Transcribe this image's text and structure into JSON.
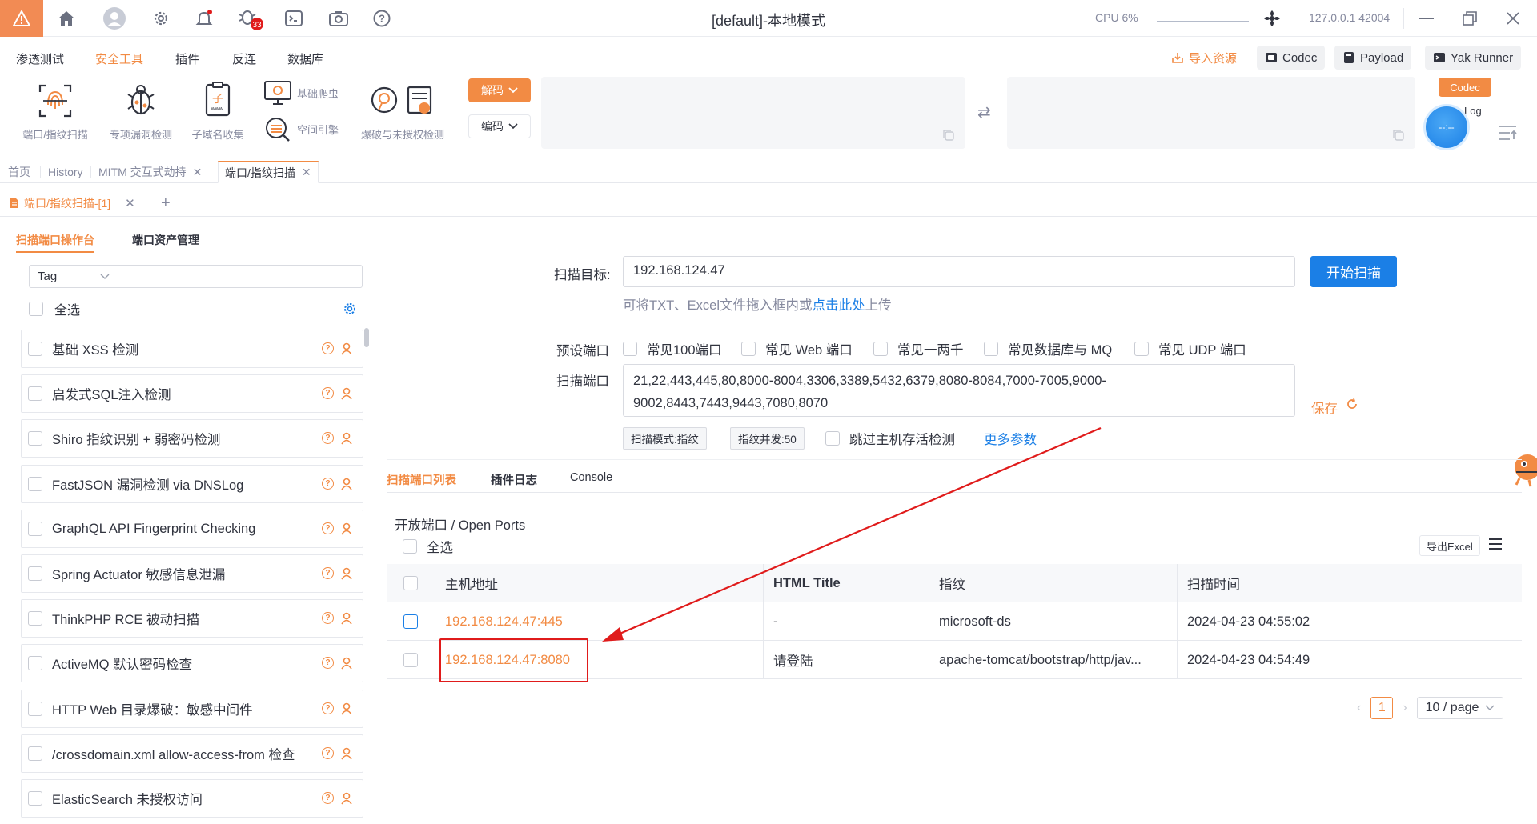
{
  "titlebar": {
    "title": "[default]-本地模式",
    "cpu": "CPU 6%",
    "address": "127.0.0.1 42004",
    "badge": "33"
  },
  "menu": {
    "items": [
      "渗透测试",
      "安全工具",
      "插件",
      "反连",
      "数据库"
    ],
    "active": "安全工具",
    "right": {
      "import": "导入资源",
      "codec": "Codec",
      "payload": "Payload",
      "runner": "Yak Runner"
    }
  },
  "toolbar": {
    "port_scan": "端口/指纹扫描",
    "vuln_detect": "专项漏洞检测",
    "subdomain": "子域名收集",
    "crawler": "基础爬虫",
    "space_engine": "空间引擎",
    "brute": "爆破与未授权检测",
    "decode": "解码",
    "encode": "编码",
    "codec_tag": "Codec",
    "log_tag": "Log",
    "float_time": "--:--"
  },
  "page_tabs": [
    {
      "label": "首页",
      "closable": false
    },
    {
      "label": "History",
      "closable": false
    },
    {
      "label": "MITM 交互式劫持",
      "closable": true
    },
    {
      "label": "端口/指纹扫描",
      "closable": true,
      "active": true
    }
  ],
  "sub_tab": {
    "label": "端口/指纹扫描-[1]"
  },
  "console_tabs": [
    "扫描端口操作台",
    "端口资产管理"
  ],
  "left": {
    "tag_label": "Tag",
    "select_all": "全选",
    "plugins": [
      "基础 XSS 检测",
      "启发式SQL注入检测",
      "Shiro 指纹识别 + 弱密码检测",
      "FastJSON 漏洞检测 via DNSLog",
      "GraphQL API Fingerprint Checking",
      "Spring Actuator 敏感信息泄漏",
      "ThinkPHP RCE 被动扫描",
      "ActiveMQ 默认密码检查",
      "HTTP Web 目录爆破：敏感中间件",
      "/crossdomain.xml allow-access-from 检查",
      "ElasticSearch 未授权访问"
    ]
  },
  "form": {
    "target_label": "扫描目标:",
    "target_value": "192.168.124.47",
    "start_button": "开始扫描",
    "hint_prefix": "可将TXT、Excel文件拖入框内或",
    "hint_link": "点击此处",
    "hint_suffix": "上传",
    "preset_label": "预设端口",
    "presets": [
      "常见100端口",
      "常见 Web 端口",
      "常见一两千",
      "常见数据库与 MQ",
      "常见 UDP 端口"
    ],
    "ports_label": "扫描端口",
    "ports_value": "21,22,443,445,80,8000-8004,3306,3389,5432,6379,8080-8084,7000-7005,9000-9002,8443,7443,9443,7080,8070",
    "save": "保存",
    "mode_tag": "扫描模式:指纹",
    "concurrency_tag": "指纹并发:50",
    "skip_label": "跳过主机存活检测",
    "more_params": "更多参数"
  },
  "results": {
    "tabs": [
      "扫描端口列表",
      "插件日志",
      "Console"
    ],
    "title": "开放端口 / Open Ports",
    "select_all": "全选",
    "export": "导出Excel",
    "columns": [
      "主机地址",
      "HTML Title",
      "指纹",
      "扫描时间"
    ],
    "rows": [
      {
        "addr": "192.168.124.47:445",
        "title": "-",
        "fp": "microsoft-ds",
        "time": "2024-04-23 04:55:02"
      },
      {
        "addr": "192.168.124.47:8080",
        "title": "请登陆",
        "fp": "apache-tomcat/bootstrap/http/jav...",
        "time": "2024-04-23 04:54:49"
      }
    ],
    "pager": {
      "page": "1",
      "page_size": "10 / page"
    }
  },
  "colors": {
    "accent": "#f28b44",
    "primary": "#1b7fe6",
    "highlight": "#e01b1b"
  }
}
